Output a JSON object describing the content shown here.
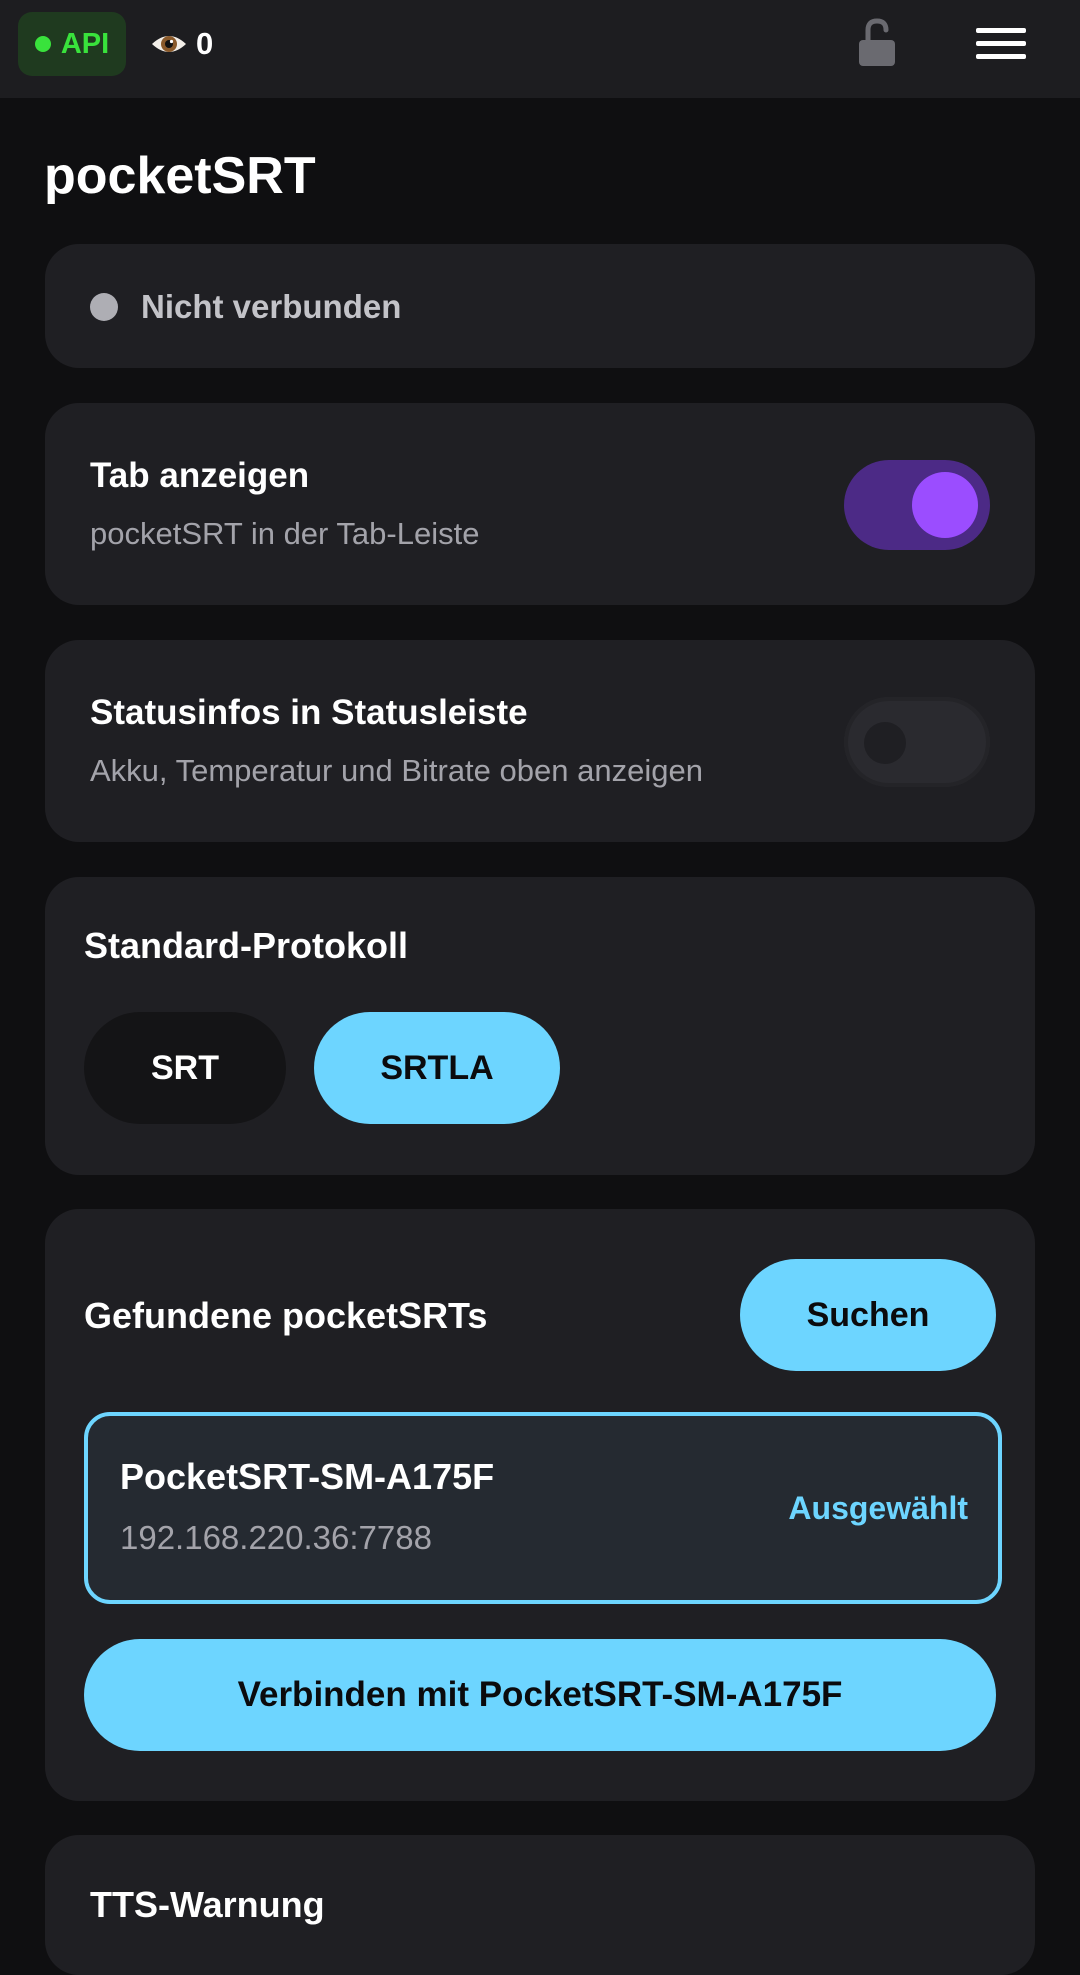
{
  "topbar": {
    "api_label": "API",
    "viewer_count": "0",
    "icons": [
      "eye-icon",
      "unlock-icon",
      "hamburger-menu-icon"
    ],
    "api_color": "#39e23c"
  },
  "page": {
    "title": "pocketSRT"
  },
  "status": {
    "text": "Nicht verbunden",
    "state": "disconnected"
  },
  "settings": [
    {
      "title": "Tab anzeigen",
      "subtitle": "pocketSRT in der Tab-Leiste",
      "enabled": true
    },
    {
      "title": "Statusinfos in Statusleiste",
      "subtitle": "Akku, Temperatur und Bitrate oben anzeigen",
      "enabled": false
    }
  ],
  "protocol": {
    "heading": "Standard-Protokoll",
    "options": [
      "SRT",
      "SRTLA"
    ],
    "selected": "SRTLA"
  },
  "devices": {
    "heading": "Gefundene pocketSRTs",
    "search_label": "Suchen",
    "items": [
      {
        "name": "PocketSRT-SM-A175F",
        "address": "192.168.220.36:7788",
        "status": "Ausgewählt"
      }
    ],
    "connect_label": "Verbinden mit PocketSRT-SM-A175F"
  },
  "tts": {
    "heading": "TTS-Warnung"
  },
  "colors": {
    "accent": "#6dd5ff",
    "toggle_on": "#9b4dff",
    "background": "#0f0f11",
    "card": "#1f1f23"
  }
}
